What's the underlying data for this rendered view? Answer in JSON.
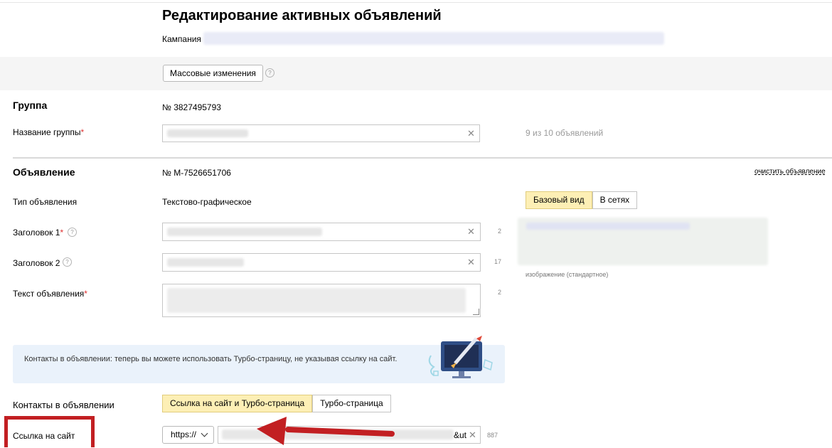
{
  "page": {
    "title": "Редактирование активных объявлений",
    "campaign_label": "Кампания"
  },
  "toolbar": {
    "bulk_button": "Массовые изменения",
    "help_icon": "question-icon"
  },
  "group": {
    "section_title": "Группа",
    "number": "№ 3827495793",
    "name_label": "Название группы",
    "required_mark": "*",
    "ads_count": "9 из 10 объявлений"
  },
  "ad": {
    "section_title": "Объявление",
    "number": "№ M-7526651706",
    "clear_link": "очистить объявление",
    "type_label": "Тип объявления",
    "type_value": "Текстово-графическое",
    "title1_label": "Заголовок 1",
    "title1_counter": "2",
    "title2_label": "Заголовок 2",
    "title2_counter": "17",
    "text_label": "Текст объявления",
    "text_counter": "2",
    "preview_tabs": [
      "Базовый вид",
      "В сетях"
    ],
    "preview_caption": "изображение (стандартное)"
  },
  "banner": {
    "text": "Контакты в объявлении: теперь вы можете использовать Турбо-страницу, не указывая ссылку на сайт."
  },
  "contacts": {
    "label": "Контакты в объявлении",
    "options": [
      "Ссылка на сайт и Турбо-страница",
      "Турбо-страница"
    ],
    "url_label": "Ссылка на сайт",
    "protocol": "https://",
    "url_suffix": "&ut",
    "url_counter": "887"
  },
  "colors": {
    "selected_segment": "#fdefb5",
    "banner_bg": "#eaf2fb",
    "highlight_red": "#c21f22",
    "required": "#e03131"
  }
}
